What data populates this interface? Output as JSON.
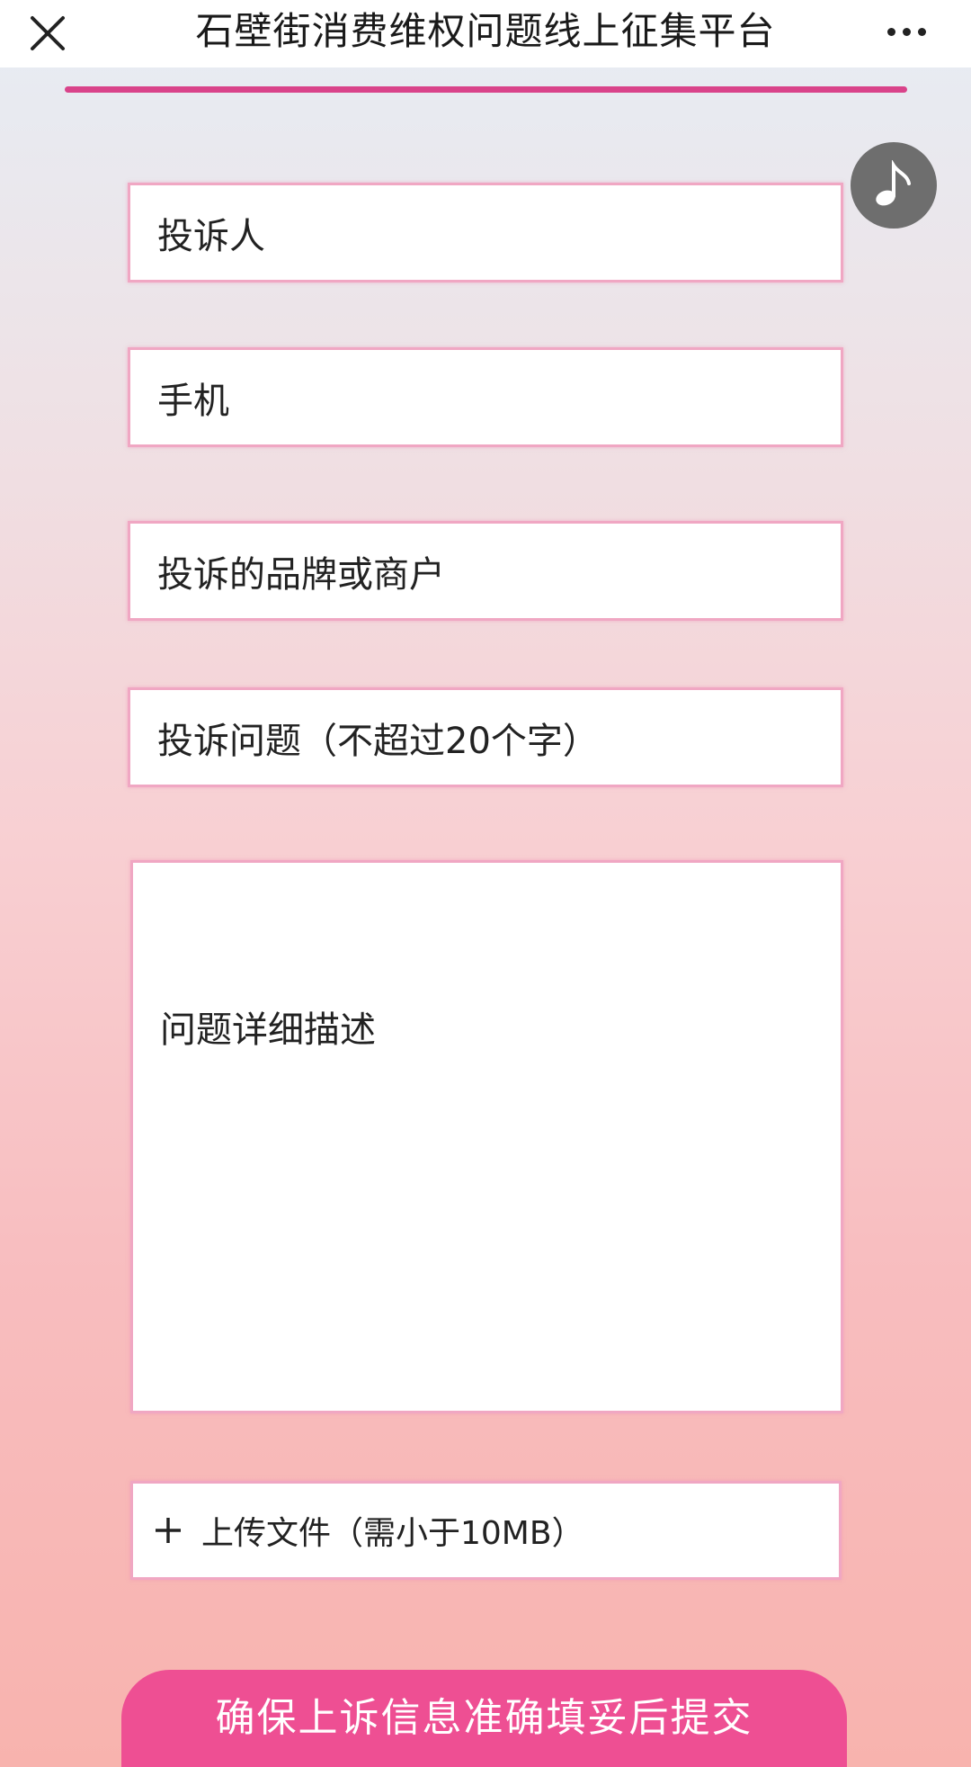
{
  "header": {
    "title": "石壁街消费维权问题线上征集平台",
    "close_icon": "close-icon",
    "more_icon": "more-icon"
  },
  "progress": {
    "fraction": 1.0,
    "color": "#d9438a"
  },
  "music": {
    "icon": "music-note-icon"
  },
  "form": {
    "name_placeholder": "投诉人",
    "phone_placeholder": "手机",
    "brand_placeholder": "投诉的品牌或商户",
    "issue_placeholder": "投诉问题（不超过20个字）",
    "detail_placeholder": "问题详细描述",
    "upload_label": "上传文件（需小于10MB）",
    "upload_icon": "plus-icon"
  },
  "submit": {
    "label": "确保上诉信息准确填妥后提交",
    "color": "#ee4f93"
  },
  "colors": {
    "field_border": "#f0a7c3",
    "accent": "#d9438a"
  }
}
